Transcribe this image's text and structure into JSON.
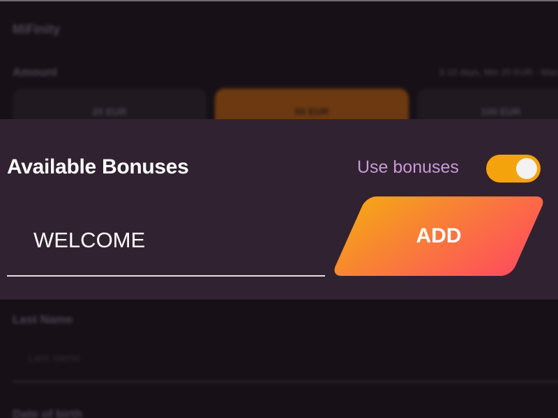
{
  "background": {
    "payment_method": "MiFinity",
    "amount_label": "Amount",
    "limits_text": "3-10 days, Min 20 EUR - Max",
    "amount_options": [
      {
        "label": "20 EUR",
        "selected": false
      },
      {
        "label": "50 EUR",
        "selected": true
      },
      {
        "label": "100 EUR",
        "selected": false
      }
    ],
    "last_name_label": "Last Name",
    "last_name_placeholder": "Last name",
    "dob_label": "Date of birth"
  },
  "bonuses": {
    "title": "Available Bonuses",
    "use_bonuses_label": "Use bonuses",
    "use_bonuses_enabled": true,
    "code_value": "WELCOME",
    "add_label": "ADD"
  },
  "colors": {
    "panel": "#312231",
    "accent_orange": "#f5a30c",
    "button_gradient_start": "#f5a418",
    "button_gradient_end": "#ff4e5c",
    "use_bonuses_text": "#c89ad6"
  }
}
